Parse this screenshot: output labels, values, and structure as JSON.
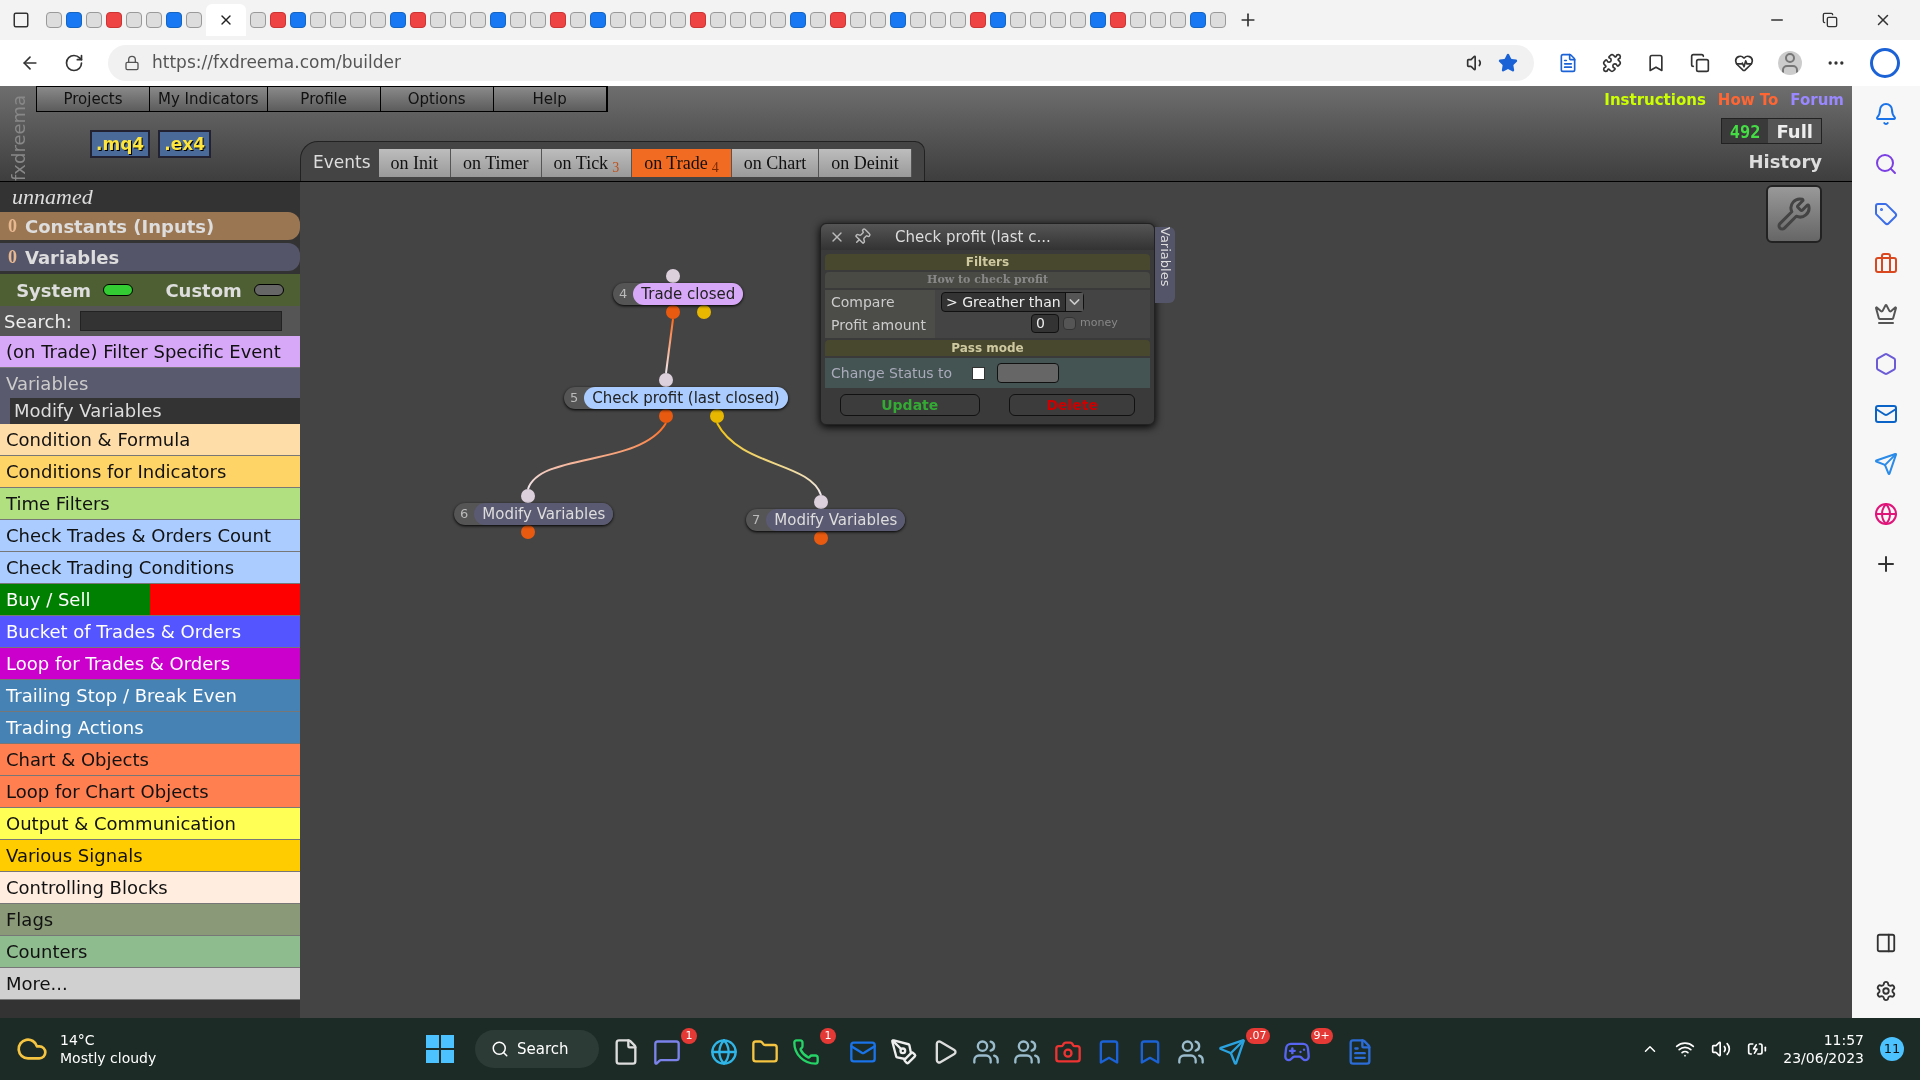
{
  "browser": {
    "url": "https://fxdreema.com/builder"
  },
  "app": {
    "brand": "fxdreema",
    "menu": [
      {
        "label": "Projects"
      },
      {
        "label": "My Indicators"
      },
      {
        "label": "Profile"
      },
      {
        "label": "Options"
      },
      {
        "label": "Help"
      }
    ],
    "file_buttons": [
      {
        "label": ".mq4"
      },
      {
        "label": ".ex4"
      }
    ],
    "links": [
      {
        "label": "Instructions",
        "color": "#ccff00"
      },
      {
        "label": "How To",
        "color": "#ff6633"
      },
      {
        "label": "Forum",
        "color": "#9988ff"
      }
    ],
    "counter": "492",
    "full_label": "Full",
    "history_label": "History",
    "events_label": "Events",
    "tabs": [
      {
        "label": "on Init",
        "selected": false
      },
      {
        "label": "on Timer",
        "selected": false
      },
      {
        "label": "on Tick",
        "count": "3",
        "selected": false
      },
      {
        "label": "on Trade",
        "count": "4",
        "selected": true
      },
      {
        "label": "on Chart",
        "selected": false
      },
      {
        "label": "on Deinit",
        "selected": false
      }
    ]
  },
  "sidebar": {
    "project_name": "unnamed",
    "sections": [
      {
        "count": "0",
        "label": "Constants (Inputs)",
        "color": "#9b7653"
      },
      {
        "count": "0",
        "label": "Variables",
        "color": "#55556a"
      }
    ],
    "toggles": [
      {
        "label": "System",
        "on": true
      },
      {
        "label": "Custom",
        "on": false
      }
    ],
    "search_label": "Search:",
    "filter_item": {
      "label": "(on Trade) Filter Specific Event"
    },
    "group_header": "Variables",
    "group_item": "Modify Variables",
    "categories": [
      {
        "label": "Condition & Formula",
        "color": "#ffdda8"
      },
      {
        "label": "Conditions for Indicators",
        "color": "#ffd466"
      },
      {
        "label": "Time Filters",
        "color": "#b0e080"
      },
      {
        "label": "Check Trades & Orders Count",
        "color": "#aaccff"
      },
      {
        "label": "Check Trading Conditions",
        "color": "#aaccff"
      },
      {
        "label": "Buy / Sell",
        "color": "#008000",
        "right_part": {
          "color": "#ff0000"
        }
      },
      {
        "label": "Bucket of Trades & Orders",
        "color": "#5555ff"
      },
      {
        "label": "Loop for Trades & Orders",
        "color": "#cc00cc"
      },
      {
        "label": "Trailing Stop / Break Even",
        "color": "#4682b4"
      },
      {
        "label": "Trading Actions",
        "color": "#4682b4"
      },
      {
        "label": "Chart & Objects",
        "color": "#ff7f50"
      },
      {
        "label": "Loop for Chart Objects",
        "color": "#ff7f50"
      },
      {
        "label": "Output & Communication",
        "color": "#ffff55"
      },
      {
        "label": "Various Signals",
        "color": "#ffcc00"
      },
      {
        "label": "Controlling Blocks",
        "color": "#ffeee0"
      },
      {
        "label": "Flags",
        "color": "#8a9a78"
      },
      {
        "label": "Counters",
        "color": "#8fbc8f"
      },
      {
        "label": "More...",
        "color": "#d0d0d0"
      }
    ]
  },
  "canvas": {
    "nodes": [
      {
        "number": "4",
        "label": "Trade closed",
        "color": "#d8a8f8"
      },
      {
        "number": "5",
        "label": "Check profit (last closed)",
        "color": "#aaccff"
      },
      {
        "number": "6",
        "label": "Modify Variables",
        "color": "#5a5a72"
      },
      {
        "number": "7",
        "label": "Modify Variables",
        "color": "#5a5a72"
      }
    ]
  },
  "dialog": {
    "title": "Check profit (last c...",
    "side_tab": "Variables",
    "section_1": "Filters",
    "subsection": "How to check profit",
    "compare_label": "Compare",
    "compare_value": "> Greather than",
    "amount_label": "Profit amount",
    "amount_value": "0",
    "money_label": "money",
    "money_checked": false,
    "section_2": "Pass mode",
    "status_label": "Change Status to",
    "status_checked": false,
    "update_label": "Update",
    "delete_label": "Delete"
  },
  "taskbar": {
    "temperature": "14°C",
    "weather": "Mostly cloudy",
    "search": "Search",
    "apps": [
      {
        "kind": "files"
      },
      {
        "kind": "chat",
        "badge": "1"
      },
      {
        "kind": "browser"
      },
      {
        "kind": "folder"
      },
      {
        "kind": "phone",
        "badge": "1"
      },
      {
        "kind": "mail"
      },
      {
        "kind": "pen"
      },
      {
        "kind": "play"
      },
      {
        "kind": "people"
      },
      {
        "kind": "people"
      },
      {
        "kind": "ig"
      },
      {
        "kind": "p"
      },
      {
        "kind": "p"
      },
      {
        "kind": "people"
      },
      {
        "kind": "send",
        "badge": ".07"
      },
      {
        "kind": "game",
        "badge": "9+"
      },
      {
        "kind": "doc"
      }
    ],
    "time": "11:57",
    "date": "23/06/2023",
    "notifications": "11"
  }
}
